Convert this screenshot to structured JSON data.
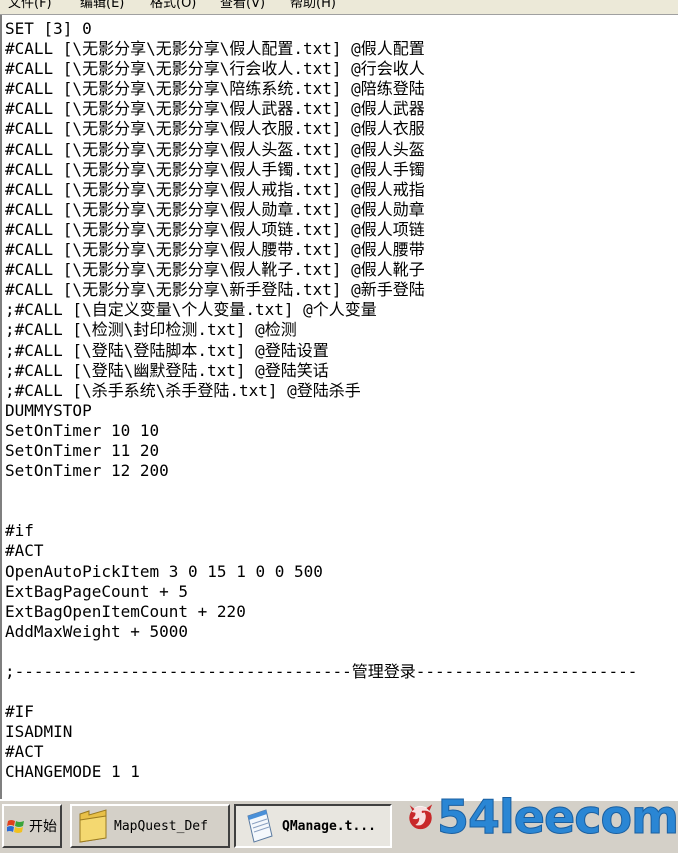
{
  "menu": {
    "items": [
      "文件(F)",
      "编辑(E)",
      "格式(O)",
      "查看(V)",
      "帮助(H)"
    ]
  },
  "editor": {
    "lines": [
      "SET [3] 0",
      "#CALL [\\无影分享\\无影分享\\假人配置.txt] @假人配置",
      "#CALL [\\无影分享\\无影分享\\行会收人.txt] @行会收人",
      "#CALL [\\无影分享\\无影分享\\陪练系统.txt] @陪练登陆",
      "#CALL [\\无影分享\\无影分享\\假人武器.txt] @假人武器",
      "#CALL [\\无影分享\\无影分享\\假人衣服.txt] @假人衣服",
      "#CALL [\\无影分享\\无影分享\\假人头盔.txt] @假人头盔",
      "#CALL [\\无影分享\\无影分享\\假人手镯.txt] @假人手镯",
      "#CALL [\\无影分享\\无影分享\\假人戒指.txt] @假人戒指",
      "#CALL [\\无影分享\\无影分享\\假人勋章.txt] @假人勋章",
      "#CALL [\\无影分享\\无影分享\\假人项链.txt] @假人项链",
      "#CALL [\\无影分享\\无影分享\\假人腰带.txt] @假人腰带",
      "#CALL [\\无影分享\\无影分享\\假人靴子.txt] @假人靴子",
      "#CALL [\\无影分享\\无影分享\\新手登陆.txt] @新手登陆",
      ";#CALL [\\自定义变量\\个人变量.txt] @个人变量",
      ";#CALL [\\检测\\封印检测.txt] @检测",
      ";#CALL [\\登陆\\登陆脚本.txt] @登陆设置",
      ";#CALL [\\登陆\\幽默登陆.txt] @登陆笑话",
      ";#CALL [\\杀手系统\\杀手登陆.txt] @登陆杀手",
      "DUMMYSTOP",
      "SetOnTimer 10 10",
      "SetOnTimer 11 20",
      "SetOnTimer 12 200",
      "",
      "",
      "#if",
      "#ACT",
      "OpenAutoPickItem 3 0 15 1 0 0 500",
      "ExtBagPageCount + 5",
      "ExtBagOpenItemCount + 220",
      "AddMaxWeight + 5000",
      "",
      ";-----------------------------------管理登录-----------------------",
      "",
      "#IF",
      "ISADMIN",
      "#ACT",
      "CHANGEMODE 1 1"
    ]
  },
  "taskbar": {
    "start_label": "开始",
    "tasks": [
      {
        "label": "MapQuest_Def"
      },
      {
        "label": "QManage.t..."
      }
    ]
  },
  "watermark": {
    "text": "54leecom"
  },
  "colors": {
    "taskbar_bg": "#d4d0c8",
    "watermark_blue": "#2a86d4",
    "watermark_red": "#c8282a"
  }
}
